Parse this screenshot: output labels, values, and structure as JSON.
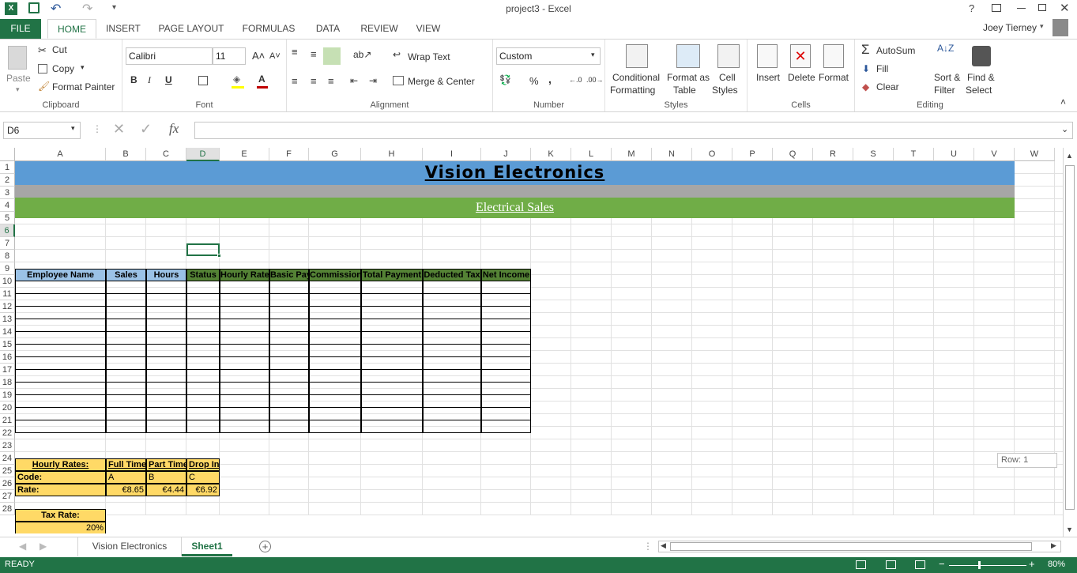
{
  "window": {
    "title": "project3 - Excel",
    "user": "Joey Tierney"
  },
  "menu": {
    "file": "FILE",
    "tabs": [
      "HOME",
      "INSERT",
      "PAGE LAYOUT",
      "FORMULAS",
      "DATA",
      "REVIEW",
      "VIEW"
    ]
  },
  "ribbon": {
    "clipboard": {
      "paste": "Paste",
      "cut": "Cut",
      "copy": "Copy",
      "format_painter": "Format Painter",
      "label": "Clipboard"
    },
    "font": {
      "name": "Calibri",
      "size": "11",
      "label": "Font",
      "bold": "B",
      "italic": "I",
      "underline": "U"
    },
    "alignment": {
      "wrap": "Wrap Text",
      "merge": "Merge & Center",
      "label": "Alignment"
    },
    "number": {
      "format": "Custom",
      "label": "Number",
      "percent": "%",
      "comma": ","
    },
    "styles": {
      "cond1": "Conditional",
      "cond2": "Formatting",
      "fmt1": "Format as",
      "fmt2": "Table",
      "cell1": "Cell",
      "cell2": "Styles",
      "label": "Styles"
    },
    "cells": {
      "insert": "Insert",
      "delete": "Delete",
      "format": "Format",
      "label": "Cells"
    },
    "editing": {
      "autosum": "AutoSum",
      "fill": "Fill",
      "clear": "Clear",
      "sort1": "Sort &",
      "sort2": "Filter",
      "find1": "Find &",
      "find2": "Select",
      "label": "Editing"
    }
  },
  "formula_bar": {
    "name_box": "D6",
    "formula": "",
    "fx": "fx"
  },
  "columns": [
    "A",
    "B",
    "C",
    "D",
    "E",
    "F",
    "G",
    "H",
    "I",
    "J",
    "K",
    "L",
    "M",
    "N",
    "O",
    "P",
    "Q",
    "R",
    "S",
    "T",
    "U",
    "V",
    "W"
  ],
  "rows": [
    "1",
    "2",
    "3",
    "4",
    "5",
    "6",
    "7",
    "8",
    "9",
    "10",
    "11",
    "12",
    "13",
    "14",
    "15",
    "16",
    "17",
    "18",
    "19",
    "20",
    "21",
    "22",
    "23",
    "24",
    "25",
    "26",
    "27",
    "28"
  ],
  "sheet": {
    "title": "Vision Electronics",
    "subtitle": "Electrical Sales",
    "headers": [
      "Employee Name",
      "Sales",
      "Hours",
      "Status",
      "Hourly Rate",
      "Basic Pay",
      "Commission",
      "Total Payment",
      "Deducted Tax",
      "Net Income"
    ],
    "rates_label": "Hourly Rates:",
    "rate_types": [
      "Full Time",
      "Part Time",
      "Drop In"
    ],
    "code_label": "Code:",
    "codes": [
      "A",
      "B",
      "C"
    ],
    "rate_label": "Rate:",
    "rates": [
      "€8.65",
      "€4.44",
      "€6.92"
    ],
    "tax_label": "Tax Rate:",
    "tax_value": "20%"
  },
  "tooltip": "Row: 1",
  "sheet_tabs": [
    "Vision Electronics",
    "Sheet1"
  ],
  "status": {
    "ready": "READY",
    "zoom": "80%"
  },
  "colors": {
    "brand": "#217346",
    "title_band": "#5b9bd5",
    "grey_band": "#a6a6a6",
    "green_band": "#70ad47",
    "header_blue": "#9bc2e6",
    "header_green": "#548235",
    "yellow": "#ffd966"
  }
}
